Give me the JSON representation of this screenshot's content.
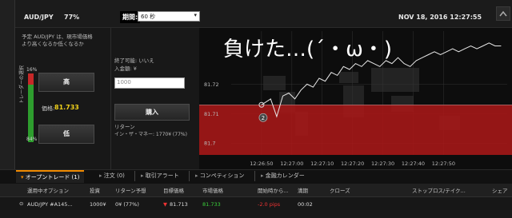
{
  "header": {
    "pair": "AUD/JPY",
    "payout": "77%",
    "expiry_label": "期間:",
    "expiry_value": "60 秒",
    "datetime": "NOV 18, 2016 12:27:55"
  },
  "trade_panel": {
    "forecast_text": "予定 AUD/JPY は、現市場価格\nより高くなるか低くなるか",
    "ratio_high": "16%",
    "ratio_low": "84%",
    "ratio_high_fraction": 0.16,
    "ratio_label": "トレーダーの選択",
    "high_label": "高",
    "low_label": "低",
    "price_label": "価格:",
    "price_value": "81.733"
  },
  "order_panel": {
    "early_close": "終了可能: いいえ",
    "amount_label": "入金額: ¥",
    "amount_placeholder": "1000",
    "buy_label": "購入",
    "return_label": "リターン",
    "return_value": "イン・ザ・マネー: 1770¥ (77%)"
  },
  "chart_overlay": {
    "text": "負けた…(´・ω・)"
  },
  "chart_data": {
    "type": "line",
    "y_ticks": [
      "81.72",
      "81.71",
      "81.7"
    ],
    "x_ticks": [
      "12:26:50",
      "12:27:00",
      "12:27:10",
      "12:27:20",
      "12:27:30",
      "12:27:40",
      "12:27:50"
    ],
    "ylim": [
      81.696,
      81.738
    ],
    "xlim_seconds": [
      -10,
      81
    ],
    "series": [
      {
        "x": [
          0,
          3,
          5,
          7,
          9,
          11,
          13,
          15,
          17,
          19,
          21,
          23,
          25,
          27,
          29,
          31,
          33,
          35,
          37,
          39,
          41,
          43,
          45,
          47,
          49,
          51,
          53,
          55,
          57,
          59,
          61,
          63,
          65,
          67,
          69,
          71,
          73,
          75,
          77,
          79
        ],
        "y": [
          81.713,
          81.715,
          81.709,
          81.716,
          81.717,
          81.715,
          81.718,
          81.72,
          81.719,
          81.722,
          81.721,
          81.724,
          81.723,
          81.726,
          81.725,
          81.727,
          81.726,
          81.728,
          81.727,
          81.726,
          81.728,
          81.727,
          81.729,
          81.727,
          81.726,
          81.728,
          81.729,
          81.73,
          81.731,
          81.73,
          81.731,
          81.732,
          81.731,
          81.732,
          81.733,
          81.732,
          81.733,
          81.734,
          81.733,
          81.733
        ]
      }
    ],
    "entry_level": 81.713,
    "entry_marker": "2",
    "loss_zone_max": 81.713
  },
  "tabs": [
    {
      "label": "オープントレード (1)"
    },
    {
      "label": "注文 (0)"
    },
    {
      "label": "取引アラート"
    },
    {
      "label": "コンペティション"
    },
    {
      "label": "金融カレンダー"
    }
  ],
  "table": {
    "headers": [
      "運用中オプション",
      "投資",
      "リターン予想",
      "目標価格",
      "市場価格",
      "開始時から...",
      "満期",
      "クローズ",
      "ストップロス/テイク...",
      "シェア"
    ],
    "row": {
      "option": "AUD/JPY #A145...",
      "investment": "1000¥",
      "expected_return": "0¥ (77%)",
      "target_price": "81.713",
      "market_price": "81.733",
      "change": "-2.0 pips",
      "expiry": "00:02"
    }
  },
  "colors": {
    "accent": "#f08a00",
    "price": "#f2d21b",
    "loss_zone": "#b71c1c",
    "chart_bg": "#0d0d0d"
  }
}
